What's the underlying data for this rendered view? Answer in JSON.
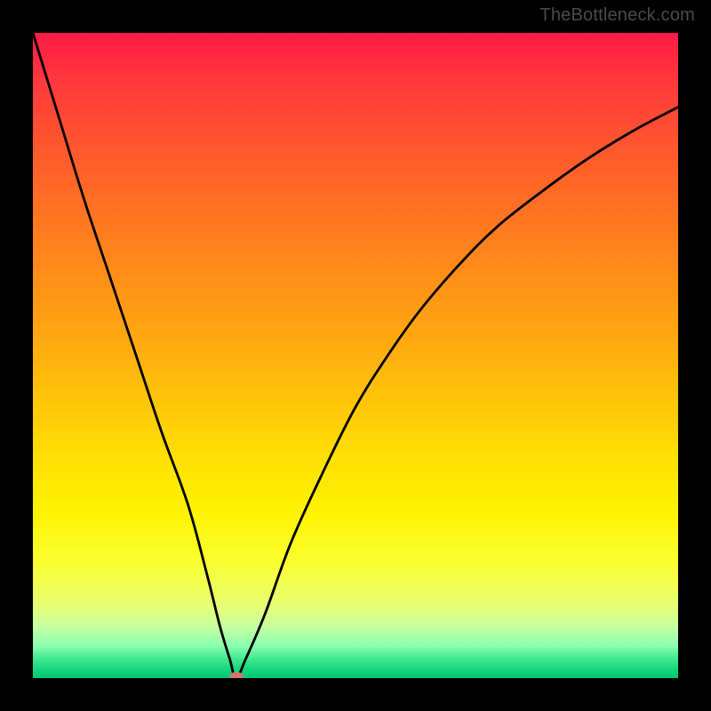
{
  "watermark": "TheBottleneck.com",
  "colors": {
    "frame": "#000000",
    "curve_stroke": "#000000",
    "marker_fill": "#c97a6a"
  },
  "chart_data": {
    "type": "line",
    "title": "",
    "xlabel": "",
    "ylabel": "",
    "xlim": [
      0,
      100
    ],
    "ylim": [
      0,
      100
    ],
    "grid": false,
    "series": [
      {
        "name": "bottleneck-curve",
        "x": [
          0,
          4,
          8,
          12,
          16,
          20,
          24,
          27,
          29,
          30.5,
          31.5,
          33,
          36,
          40,
          45,
          50,
          55,
          60,
          66,
          72,
          79,
          86,
          93,
          100
        ],
        "y_pct": [
          100,
          87,
          74,
          62,
          50,
          38,
          27,
          16,
          8,
          3,
          0,
          3,
          10,
          21,
          32,
          42,
          50,
          57,
          64,
          70,
          75.5,
          80.5,
          84.8,
          88.5
        ]
      }
    ],
    "annotations": [
      {
        "name": "optimal-marker",
        "x": 31.5,
        "y_pct": 0
      }
    ],
    "gradient_stops": [
      {
        "pos": 0,
        "color": "#ff1a44"
      },
      {
        "pos": 50,
        "color": "#ffaa10"
      },
      {
        "pos": 82,
        "color": "#fbff30"
      },
      {
        "pos": 100,
        "color": "#00c870"
      }
    ]
  }
}
